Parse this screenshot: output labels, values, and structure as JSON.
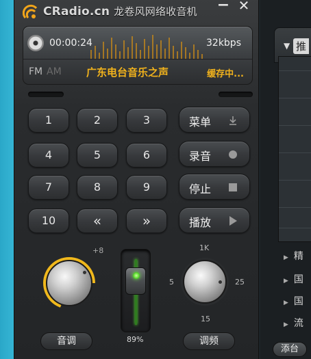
{
  "window": {
    "title_en": "CRadio.cn",
    "title_cn": "龙卷风网络收音机",
    "minimize": "−",
    "close": "✕"
  },
  "display": {
    "time": "00:00:24",
    "bitrate": "32kbps",
    "mode_fm": "FM",
    "mode_am": "AM",
    "station": "广东电台音乐之声",
    "status": "缓存中..."
  },
  "keypad": [
    "1",
    "2",
    "3",
    "4",
    "5",
    "6",
    "7",
    "8",
    "9",
    "10",
    "«",
    "»"
  ],
  "functions": {
    "menu": "菜单",
    "record": "录音",
    "stop": "停止",
    "play": "播放"
  },
  "volume": {
    "label": "音调",
    "mark_plus": "+8",
    "level_fraction": 0.72
  },
  "slider": {
    "percent_text": "89%",
    "percent": 89
  },
  "tuner": {
    "label": "调频",
    "tick_top": "1K",
    "tick_left": "5",
    "tick_right": "25",
    "tick_bottom": "15"
  },
  "side_panel": {
    "tab_label": "推",
    "categories": [
      "精",
      "国",
      "国",
      "流"
    ],
    "add_button": "添台"
  },
  "colors": {
    "accent": "#f2b31c",
    "led_green": "#55d62a"
  }
}
